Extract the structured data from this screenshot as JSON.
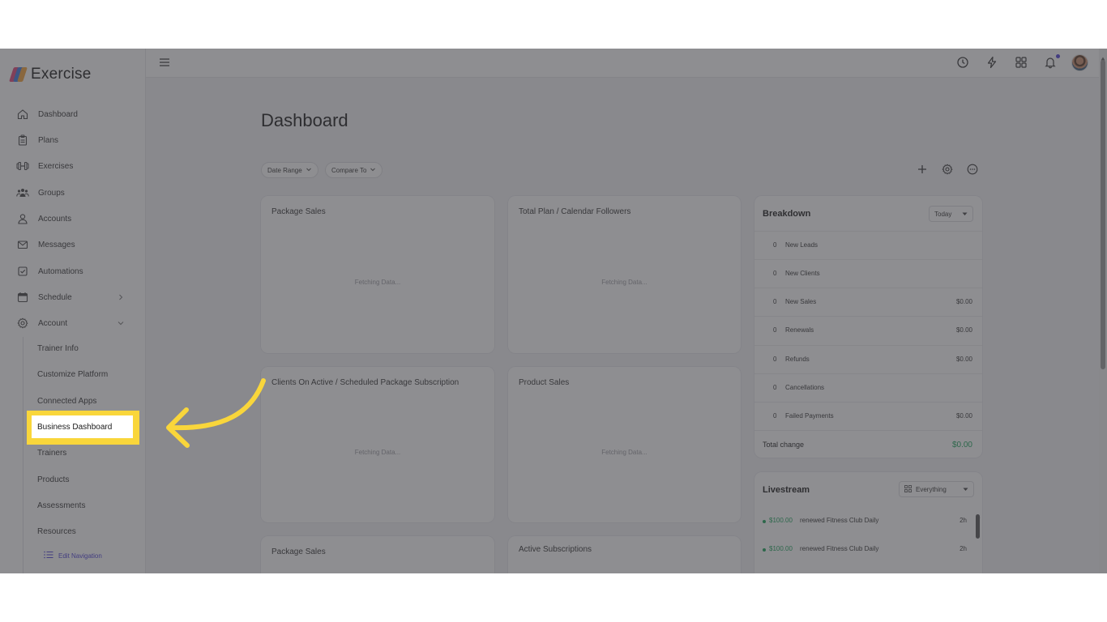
{
  "app": {
    "name": "Exercise"
  },
  "sidebar": {
    "items": [
      {
        "label": "Dashboard",
        "icon": "home-icon"
      },
      {
        "label": "Plans",
        "icon": "clipboard-icon"
      },
      {
        "label": "Exercises",
        "icon": "dumbbell-icon"
      },
      {
        "label": "Groups",
        "icon": "users-icon"
      },
      {
        "label": "Accounts",
        "icon": "user-icon"
      },
      {
        "label": "Messages",
        "icon": "mail-icon"
      },
      {
        "label": "Automations",
        "icon": "checkbox-icon"
      },
      {
        "label": "Schedule",
        "icon": "calendar-icon"
      },
      {
        "label": "Account",
        "icon": "gear-icon"
      }
    ],
    "sub_items": [
      "Trainer Info",
      "Customize Platform",
      "Connected Apps",
      "Business Dashboard",
      "Trainers",
      "Products",
      "Assessments",
      "Resources"
    ],
    "edit_navigation": "Edit Navigation"
  },
  "main": {
    "title": "Dashboard",
    "filters": {
      "date_range": "Date Range",
      "compare_to": "Compare To"
    },
    "cards": [
      {
        "title": "Package Sales",
        "status": "Fetching Data..."
      },
      {
        "title": "Total Plan / Calendar Followers",
        "status": "Fetching Data..."
      },
      {
        "title": "Clients On Active / Scheduled Package Subscription",
        "status": "Fetching Data..."
      },
      {
        "title": "Product Sales",
        "status": "Fetching Data..."
      },
      {
        "title": "Package Sales"
      },
      {
        "title": "Active Subscriptions"
      }
    ]
  },
  "breakdown": {
    "title": "Breakdown",
    "period": "Today",
    "rows": [
      {
        "count": "0",
        "label": "New Leads",
        "amount": ""
      },
      {
        "count": "0",
        "label": "New Clients",
        "amount": ""
      },
      {
        "count": "0",
        "label": "New Sales",
        "amount": "$0.00"
      },
      {
        "count": "0",
        "label": "Renewals",
        "amount": "$0.00"
      },
      {
        "count": "0",
        "label": "Refunds",
        "amount": "$0.00"
      },
      {
        "count": "0",
        "label": "Cancellations",
        "amount": ""
      },
      {
        "count": "0",
        "label": "Failed Payments",
        "amount": "$0.00"
      }
    ],
    "total_label": "Total change",
    "total_amount": "$0.00"
  },
  "livestream": {
    "title": "Livestream",
    "filter": "Everything",
    "events": [
      {
        "amount": "$100.00",
        "text": "renewed Fitness Club Daily",
        "time": "2h"
      },
      {
        "amount": "$100.00",
        "text": "renewed Fitness Club Daily",
        "time": "2h"
      }
    ]
  },
  "colors": {
    "accent": "#4c3fd6",
    "highlight": "#f9d63b",
    "positive": "#1aa35a"
  }
}
